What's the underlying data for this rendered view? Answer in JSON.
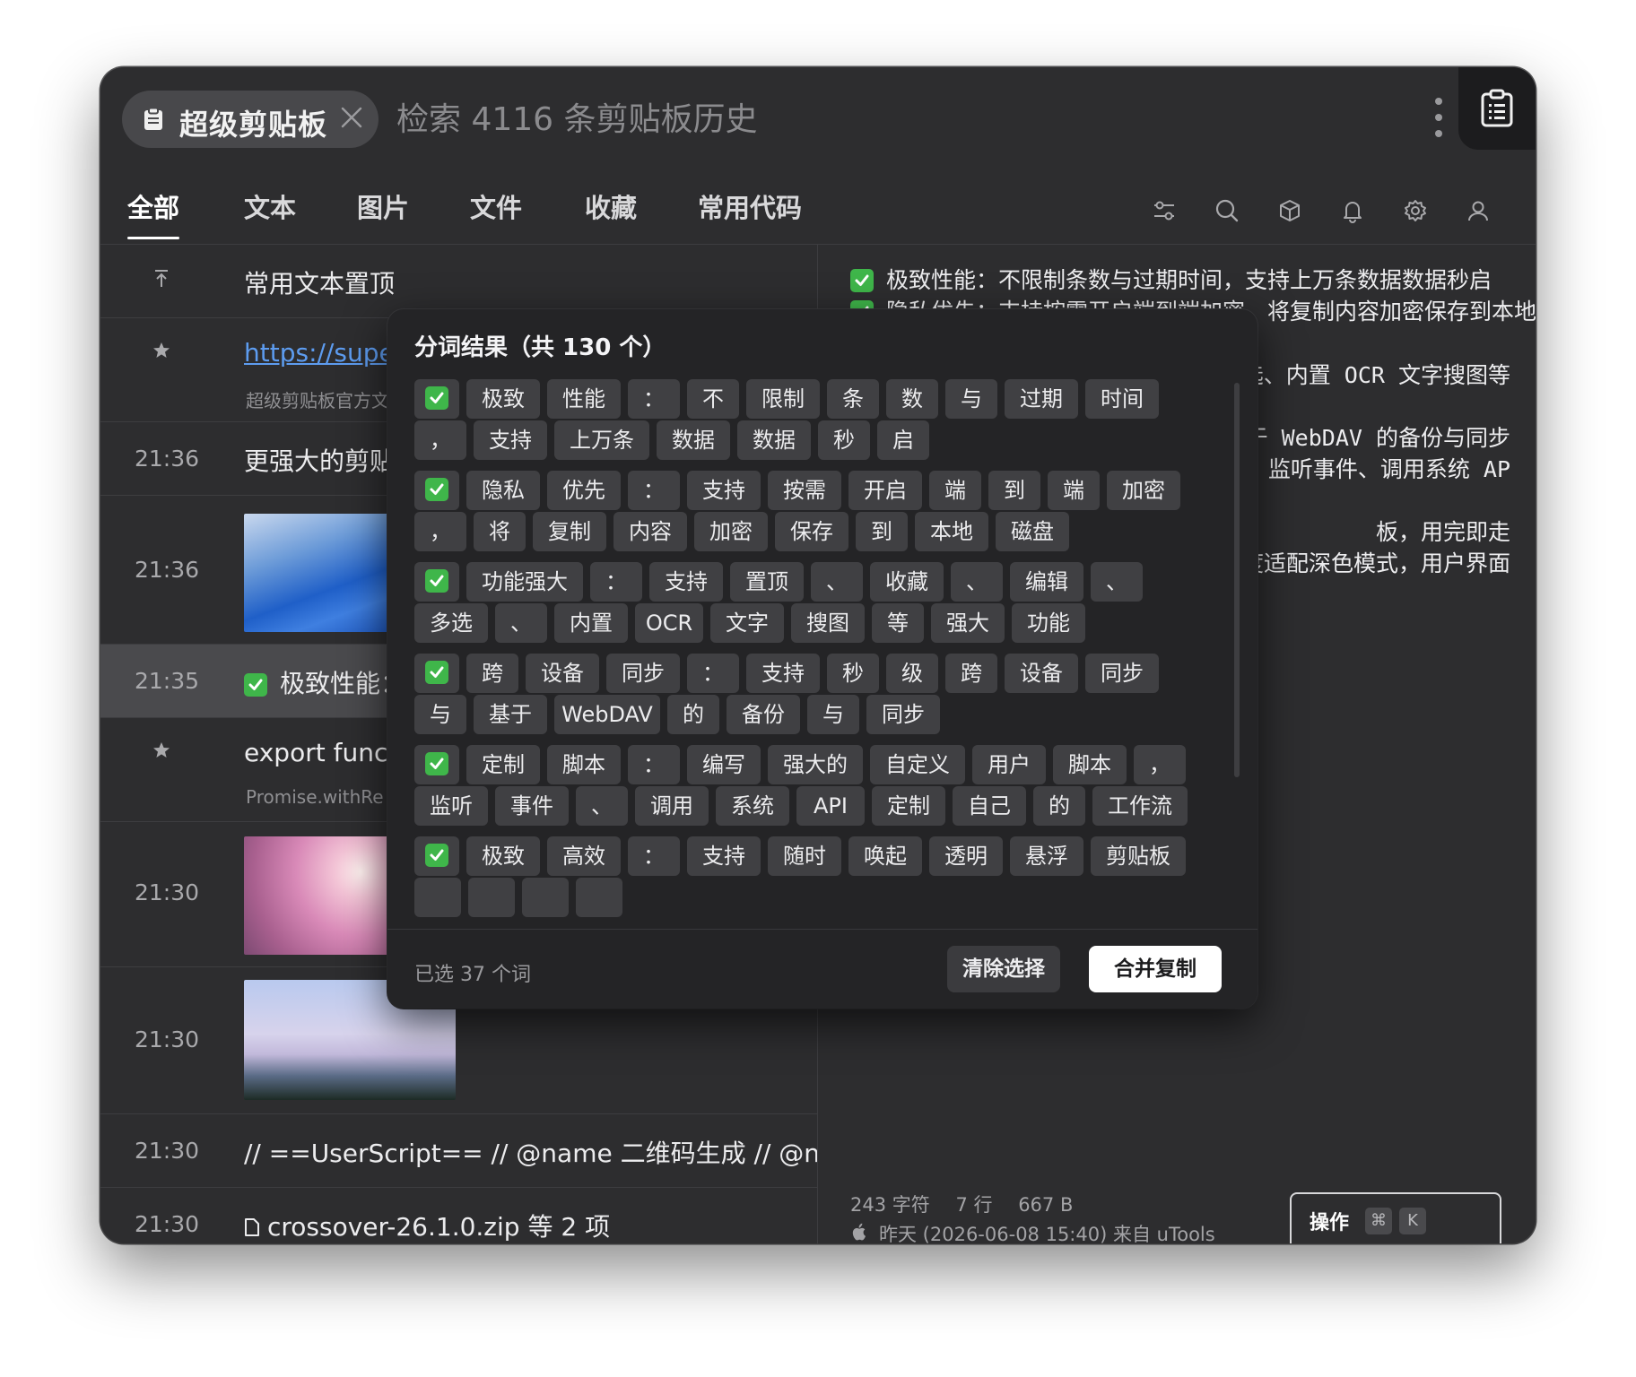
{
  "app": {
    "chip_name": "超级剪贴板",
    "search_placeholder": "检索 4116 条剪贴板历史"
  },
  "tabs": [
    "全部",
    "文本",
    "图片",
    "文件",
    "收藏",
    "常用代码"
  ],
  "toolbar_icons": [
    "sliders-icon",
    "search-icon",
    "box-icon",
    "bell-icon",
    "gear-icon",
    "user-icon"
  ],
  "list": {
    "pinned_title": "常用文本置顶",
    "link_text": "https://super",
    "link_sub": "超级剪贴板官方文",
    "r3_time": "21:36",
    "r3_text": "更强大的剪贴",
    "r4_time": "21:36",
    "r5_time": "21:35",
    "r5_text": "极致性能：",
    "r6_text": "export funct",
    "r6_sub": "Promise.withRe",
    "r7_time": "21:30",
    "r8_time": "21:30",
    "r9_time": "21:30",
    "r9_text": "// ==UserScript== // @name 二维码生成 // @na...",
    "r10_time": "21:30",
    "r10_text": "crossover-26.1.0.zip 等 2 项"
  },
  "preview": {
    "line1": "极致性能：不限制条数与过期时间，支持上万条数据数据秒启",
    "line2": "隐私优先：支持按需开启端到端加密，将复制内容加密保存到本地",
    "frag1": "选、内置 OCR 文字搜图等",
    "frag2": "于 WebDAV 的备份与同步",
    "frag3": "，监听事件、调用系统 AP",
    "frag4": "板，用完即走",
    "frag5": "度适配深色模式，用户界面",
    "chars": "243 字符",
    "lines": "7 行",
    "size": "667 B",
    "source": "昨天 (2026-06-08 15:40)  来自 uTools",
    "action_label": "操作",
    "key1": "⌘",
    "key2": "K"
  },
  "popup": {
    "title": "分词结果（共 130 个）",
    "selected": "已选 37 个词",
    "clear": "清除选择",
    "merge": "合并复制",
    "groups": [
      [
        [
          "极致",
          "性能",
          "：",
          "不",
          "限制",
          "条",
          "数",
          "与",
          "过期",
          "时间"
        ],
        [
          "，",
          "支持",
          "上万条",
          "数据",
          "数据",
          "秒",
          "启"
        ]
      ],
      [
        [
          "隐私",
          "优先",
          "：",
          "支持",
          "按需",
          "开启",
          "端",
          "到",
          "端",
          "加密"
        ],
        [
          "，",
          "将",
          "复制",
          "内容",
          "加密",
          "保存",
          "到",
          "本地",
          "磁盘"
        ]
      ],
      [
        [
          "功能强大",
          "：",
          "支持",
          "置顶",
          "、",
          "收藏",
          "、",
          "编辑",
          "、"
        ],
        [
          "多选",
          "、",
          "内置",
          "OCR",
          "文字",
          "搜图",
          "等",
          "强大",
          "功能"
        ]
      ],
      [
        [
          "跨",
          "设备",
          "同步",
          "：",
          "支持",
          "秒",
          "级",
          "跨",
          "设备",
          "同步"
        ],
        [
          "与",
          "基于",
          "WebDAV",
          "的",
          "备份",
          "与",
          "同步"
        ]
      ],
      [
        [
          "定制",
          "脚本",
          "：",
          "编写",
          "强大的",
          "自定义",
          "用户",
          "脚本",
          "，"
        ],
        [
          "监听",
          "事件",
          "、",
          "调用",
          "系统",
          "API",
          "定制",
          "自己",
          "的",
          "工作流"
        ]
      ],
      [
        [
          "极致",
          "高效",
          "：",
          "支持",
          "随时",
          "唤起",
          "透明",
          "悬浮",
          "剪贴板"
        ],
        [
          "",
          "",
          "",
          ""
        ]
      ]
    ]
  },
  "colors": {
    "bg": "#2d2d2f",
    "accent_check": "#3fb64a",
    "link": "#5d9cf0"
  }
}
